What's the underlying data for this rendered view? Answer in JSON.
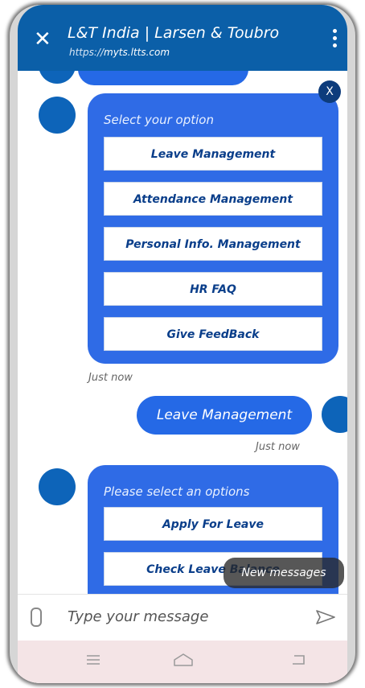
{
  "header": {
    "title": "L&T India | Larsen & Toubro",
    "url_prefix": "https://",
    "url_host": "myts.ltts.com",
    "close_icon": "close-icon",
    "menu_icon": "more-vert-icon"
  },
  "chat": {
    "close_badge": "X",
    "bot_card_1": {
      "prompt": "Select your option",
      "options": [
        "Leave Management",
        "Attendance Management",
        "Personal Info. Management",
        "HR FAQ",
        "Give FeedBack"
      ],
      "timestamp": "Just now"
    },
    "user_message": {
      "text": "Leave Management",
      "timestamp": "Just now"
    },
    "bot_card_2": {
      "prompt": "Please select an options",
      "options": [
        "Apply For Leave",
        "Check Leave Balance"
      ]
    },
    "new_messages": "New messages"
  },
  "composer": {
    "placeholder": "Type your message"
  },
  "colors": {
    "header": "#0b5fa8",
    "card": "#2f6be6",
    "avatar": "#0d64b9",
    "option_text": "#0a3e8a"
  }
}
